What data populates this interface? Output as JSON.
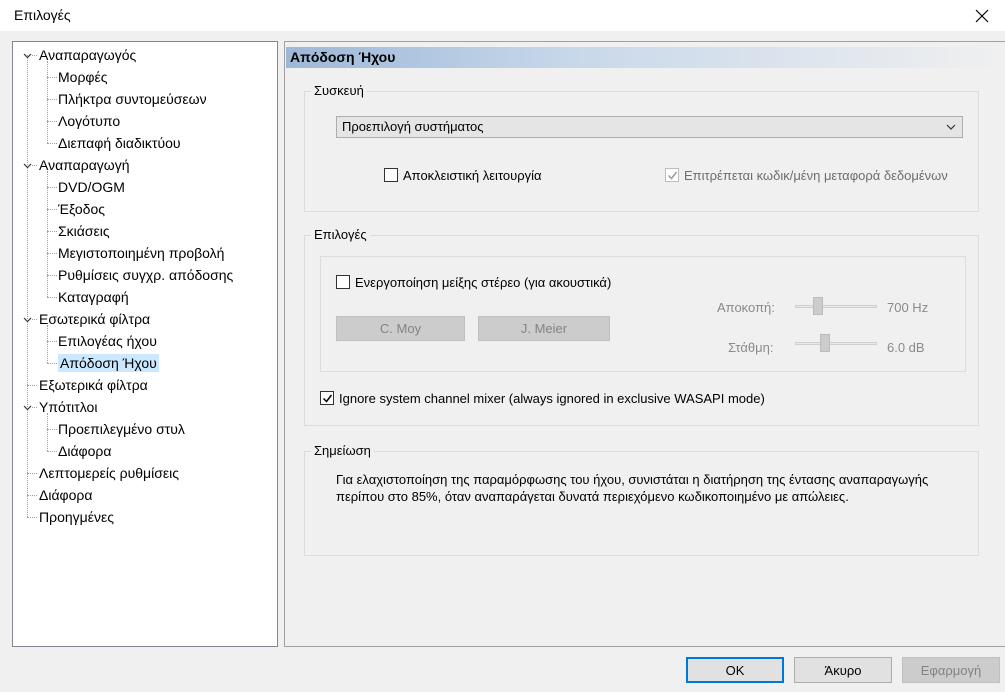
{
  "window": {
    "title": "Επιλογές"
  },
  "tree": {
    "items": [
      {
        "label": "Αναπαραγωγός",
        "level": 0,
        "expanded": true
      },
      {
        "label": "Μορφές",
        "level": 1
      },
      {
        "label": "Πλήκτρα συντομεύσεων",
        "level": 1
      },
      {
        "label": "Λογότυπο",
        "level": 1
      },
      {
        "label": "Διεπαφή διαδικτύου",
        "level": 1
      },
      {
        "label": "Αναπαραγωγή",
        "level": 0,
        "expanded": true
      },
      {
        "label": "DVD/OGM",
        "level": 1
      },
      {
        "label": "Έξοδος",
        "level": 1
      },
      {
        "label": "Σκιάσεις",
        "level": 1
      },
      {
        "label": "Μεγιστοποιημένη προβολή",
        "level": 1
      },
      {
        "label": "Ρυθμίσεις συγχρ. απόδοσης",
        "level": 1
      },
      {
        "label": "Καταγραφή",
        "level": 1
      },
      {
        "label": "Εσωτερικά φίλτρα",
        "level": 0,
        "expanded": true
      },
      {
        "label": "Επιλογέας ήχου",
        "level": 1
      },
      {
        "label": "Απόδοση Ήχου",
        "level": 1,
        "selected": true
      },
      {
        "label": "Εξωτερικά φίλτρα",
        "level": 0
      },
      {
        "label": "Υπότιτλοι",
        "level": 0,
        "expanded": true
      },
      {
        "label": "Προεπιλεγμένο στυλ",
        "level": 1
      },
      {
        "label": "Διάφορα",
        "level": 1
      },
      {
        "label": "Λεπτομερείς ρυθμίσεις",
        "level": 0
      },
      {
        "label": "Διάφορα",
        "level": 0
      },
      {
        "label": "Προηγμένες",
        "level": 0
      }
    ]
  },
  "page": {
    "title": "Απόδοση Ήχου",
    "device": {
      "legend": "Συσκευή",
      "selected": "Προεπιλογή συστήματος",
      "exclusive_label": "Αποκλειστική λειτουργία",
      "exclusive_checked": false,
      "bitstream_label": "Επιτρέπεται κωδικ/μένη μεταφορά δεδομένων",
      "bitstream_checked": true
    },
    "options": {
      "legend": "Επιλογές",
      "crossfeed_label": "Ενεργοποίηση μείξης στέρεο (για ακουστικά)",
      "crossfeed_checked": false,
      "cmoy_label": "C. Moy",
      "jmeier_label": "J. Meier",
      "cutoff_label": "Αποκοπή:",
      "cutoff_value": "700 Hz",
      "cutoff_fraction": 0.25,
      "level_label": "Στάθμη:",
      "level_value": "6.0 dB",
      "level_fraction": 0.35,
      "ignore_mixer_label": "Ignore system channel mixer (always ignored in exclusive WASAPI mode)",
      "ignore_mixer_checked": true
    },
    "note": {
      "legend": "Σημείωση",
      "line1": "Για ελαχιστοποίηση της παραμόρφωσης του ήχου, συνιστάται η διατήρηση της έντασης αναπαραγωγής",
      "line2": "περίπου στο 85%, όταν αναπαράγεται δυνατά περιεχόμενο κωδικοποιημένο με απώλειες."
    }
  },
  "buttons": {
    "ok": "OK",
    "cancel": "Άκυρο",
    "apply": "Εφαρμογή"
  },
  "colors": {
    "selection": "#cce8ff",
    "default_button_border": "#0078d7",
    "header_gradient": "#9db8d7"
  }
}
